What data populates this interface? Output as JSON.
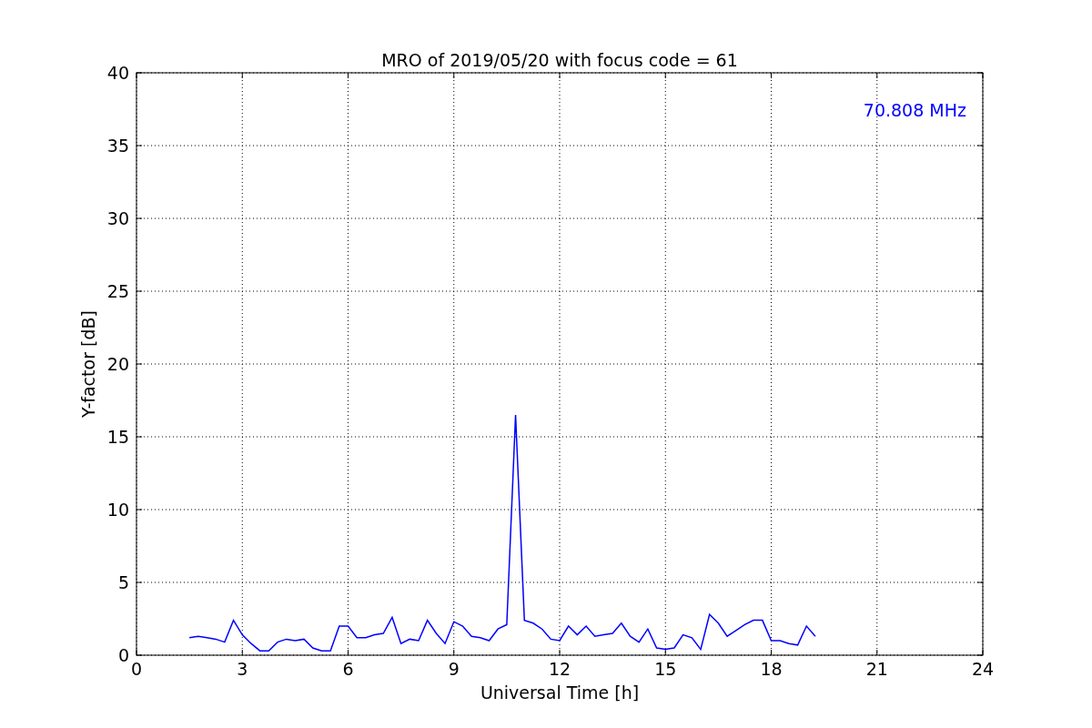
{
  "figure": {
    "chart_data": {
      "type": "line",
      "title": "MRO of 2019/05/20 with focus code = 61",
      "xlabel": "Universal Time [h]",
      "ylabel": "Y-factor [dB]",
      "x": [
        1.5,
        1.75,
        2.0,
        2.25,
        2.5,
        2.75,
        3.0,
        3.25,
        3.5,
        3.75,
        4.0,
        4.25,
        4.5,
        4.75,
        5.0,
        5.25,
        5.5,
        5.75,
        6.0,
        6.25,
        6.5,
        6.75,
        7.0,
        7.25,
        7.5,
        7.75,
        8.0,
        8.25,
        8.5,
        8.75,
        9.0,
        9.25,
        9.5,
        9.75,
        10.0,
        10.25,
        10.5,
        10.75,
        11.0,
        11.25,
        11.5,
        11.75,
        12.0,
        12.25,
        12.5,
        12.75,
        13.0,
        13.25,
        13.5,
        13.75,
        14.0,
        14.25,
        14.5,
        14.75,
        15.0,
        15.25,
        15.5,
        15.75,
        16.0,
        16.25,
        16.5,
        16.75,
        17.0,
        17.25,
        17.5,
        17.75,
        18.0,
        18.25,
        18.5,
        18.75,
        19.0,
        19.25
      ],
      "series": [
        {
          "name": "70.808 MHz",
          "color": "#0000ff",
          "values": [
            1.2,
            1.3,
            1.2,
            1.1,
            0.9,
            2.4,
            1.4,
            0.8,
            0.3,
            0.3,
            0.9,
            1.1,
            1.0,
            1.1,
            0.5,
            0.3,
            0.3,
            2.0,
            2.0,
            1.2,
            1.2,
            1.4,
            1.5,
            2.6,
            0.8,
            1.1,
            1.0,
            2.4,
            1.5,
            0.8,
            2.3,
            2.0,
            1.3,
            1.2,
            1.0,
            1.8,
            2.1,
            16.5,
            2.4,
            2.2,
            1.8,
            1.1,
            1.0,
            2.0,
            1.4,
            2.0,
            1.3,
            1.4,
            1.5,
            2.2,
            1.3,
            0.9,
            1.8,
            0.5,
            0.4,
            0.5,
            1.4,
            1.2,
            0.4,
            2.8,
            2.2,
            1.3,
            1.7,
            2.1,
            2.4,
            2.4,
            1.0,
            1.0,
            0.8,
            0.7,
            2.0,
            1.3
          ]
        }
      ],
      "xlim": [
        0,
        24
      ],
      "ylim": [
        0,
        40
      ],
      "xticks": [
        0,
        3,
        6,
        9,
        12,
        15,
        18,
        21,
        24
      ],
      "yticks": [
        0,
        5,
        10,
        15,
        20,
        25,
        30,
        35,
        40
      ],
      "grid": true
    }
  }
}
